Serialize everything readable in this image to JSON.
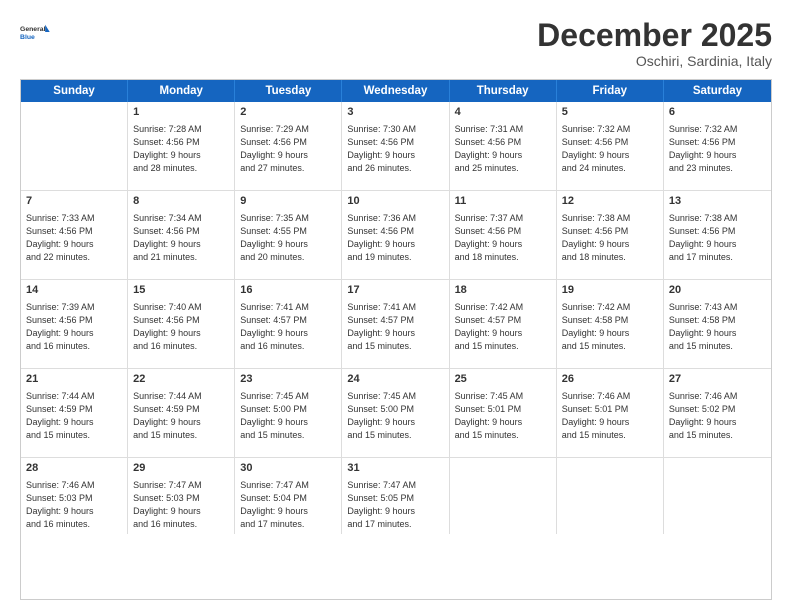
{
  "logo": {
    "line1": "General",
    "line2": "Blue"
  },
  "title": "December 2025",
  "location": "Oschiri, Sardinia, Italy",
  "weekdays": [
    "Sunday",
    "Monday",
    "Tuesday",
    "Wednesday",
    "Thursday",
    "Friday",
    "Saturday"
  ],
  "rows": [
    [
      {
        "day": "",
        "info": ""
      },
      {
        "day": "1",
        "info": "Sunrise: 7:28 AM\nSunset: 4:56 PM\nDaylight: 9 hours\nand 28 minutes."
      },
      {
        "day": "2",
        "info": "Sunrise: 7:29 AM\nSunset: 4:56 PM\nDaylight: 9 hours\nand 27 minutes."
      },
      {
        "day": "3",
        "info": "Sunrise: 7:30 AM\nSunset: 4:56 PM\nDaylight: 9 hours\nand 26 minutes."
      },
      {
        "day": "4",
        "info": "Sunrise: 7:31 AM\nSunset: 4:56 PM\nDaylight: 9 hours\nand 25 minutes."
      },
      {
        "day": "5",
        "info": "Sunrise: 7:32 AM\nSunset: 4:56 PM\nDaylight: 9 hours\nand 24 minutes."
      },
      {
        "day": "6",
        "info": "Sunrise: 7:32 AM\nSunset: 4:56 PM\nDaylight: 9 hours\nand 23 minutes."
      }
    ],
    [
      {
        "day": "7",
        "info": "Sunrise: 7:33 AM\nSunset: 4:56 PM\nDaylight: 9 hours\nand 22 minutes."
      },
      {
        "day": "8",
        "info": "Sunrise: 7:34 AM\nSunset: 4:56 PM\nDaylight: 9 hours\nand 21 minutes."
      },
      {
        "day": "9",
        "info": "Sunrise: 7:35 AM\nSunset: 4:55 PM\nDaylight: 9 hours\nand 20 minutes."
      },
      {
        "day": "10",
        "info": "Sunrise: 7:36 AM\nSunset: 4:56 PM\nDaylight: 9 hours\nand 19 minutes."
      },
      {
        "day": "11",
        "info": "Sunrise: 7:37 AM\nSunset: 4:56 PM\nDaylight: 9 hours\nand 18 minutes."
      },
      {
        "day": "12",
        "info": "Sunrise: 7:38 AM\nSunset: 4:56 PM\nDaylight: 9 hours\nand 18 minutes."
      },
      {
        "day": "13",
        "info": "Sunrise: 7:38 AM\nSunset: 4:56 PM\nDaylight: 9 hours\nand 17 minutes."
      }
    ],
    [
      {
        "day": "14",
        "info": "Sunrise: 7:39 AM\nSunset: 4:56 PM\nDaylight: 9 hours\nand 16 minutes."
      },
      {
        "day": "15",
        "info": "Sunrise: 7:40 AM\nSunset: 4:56 PM\nDaylight: 9 hours\nand 16 minutes."
      },
      {
        "day": "16",
        "info": "Sunrise: 7:41 AM\nSunset: 4:57 PM\nDaylight: 9 hours\nand 16 minutes."
      },
      {
        "day": "17",
        "info": "Sunrise: 7:41 AM\nSunset: 4:57 PM\nDaylight: 9 hours\nand 15 minutes."
      },
      {
        "day": "18",
        "info": "Sunrise: 7:42 AM\nSunset: 4:57 PM\nDaylight: 9 hours\nand 15 minutes."
      },
      {
        "day": "19",
        "info": "Sunrise: 7:42 AM\nSunset: 4:58 PM\nDaylight: 9 hours\nand 15 minutes."
      },
      {
        "day": "20",
        "info": "Sunrise: 7:43 AM\nSunset: 4:58 PM\nDaylight: 9 hours\nand 15 minutes."
      }
    ],
    [
      {
        "day": "21",
        "info": "Sunrise: 7:44 AM\nSunset: 4:59 PM\nDaylight: 9 hours\nand 15 minutes."
      },
      {
        "day": "22",
        "info": "Sunrise: 7:44 AM\nSunset: 4:59 PM\nDaylight: 9 hours\nand 15 minutes."
      },
      {
        "day": "23",
        "info": "Sunrise: 7:45 AM\nSunset: 5:00 PM\nDaylight: 9 hours\nand 15 minutes."
      },
      {
        "day": "24",
        "info": "Sunrise: 7:45 AM\nSunset: 5:00 PM\nDaylight: 9 hours\nand 15 minutes."
      },
      {
        "day": "25",
        "info": "Sunrise: 7:45 AM\nSunset: 5:01 PM\nDaylight: 9 hours\nand 15 minutes."
      },
      {
        "day": "26",
        "info": "Sunrise: 7:46 AM\nSunset: 5:01 PM\nDaylight: 9 hours\nand 15 minutes."
      },
      {
        "day": "27",
        "info": "Sunrise: 7:46 AM\nSunset: 5:02 PM\nDaylight: 9 hours\nand 15 minutes."
      }
    ],
    [
      {
        "day": "28",
        "info": "Sunrise: 7:46 AM\nSunset: 5:03 PM\nDaylight: 9 hours\nand 16 minutes."
      },
      {
        "day": "29",
        "info": "Sunrise: 7:47 AM\nSunset: 5:03 PM\nDaylight: 9 hours\nand 16 minutes."
      },
      {
        "day": "30",
        "info": "Sunrise: 7:47 AM\nSunset: 5:04 PM\nDaylight: 9 hours\nand 17 minutes."
      },
      {
        "day": "31",
        "info": "Sunrise: 7:47 AM\nSunset: 5:05 PM\nDaylight: 9 hours\nand 17 minutes."
      },
      {
        "day": "",
        "info": ""
      },
      {
        "day": "",
        "info": ""
      },
      {
        "day": "",
        "info": ""
      }
    ]
  ]
}
